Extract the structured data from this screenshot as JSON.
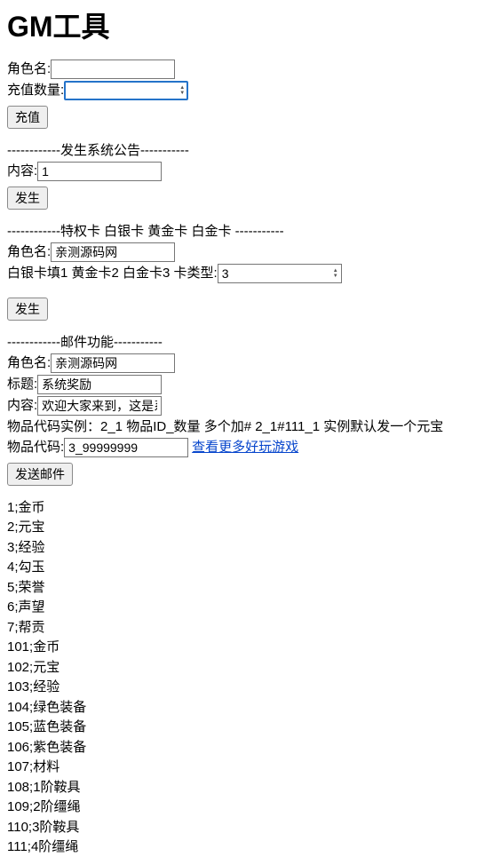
{
  "title": "GM工具",
  "recharge": {
    "role_label": "角色名:",
    "role_value": "",
    "amount_label": "充值数量:",
    "amount_value": "",
    "button": "充值"
  },
  "announce": {
    "divider": "------------发生系统公告-----------",
    "content_label": "内容:",
    "content_value": "1",
    "button": "发生"
  },
  "card": {
    "divider": "------------特权卡 白银卡 黄金卡 白金卡 -----------",
    "role_label": "角色名:",
    "role_value": "亲测源码网",
    "type_label_line": "白银卡填1 黄金卡2 白金卡3 卡类型:",
    "type_value": "3",
    "button": "发生"
  },
  "mail": {
    "divider": "------------邮件功能-----------",
    "role_label": "角色名:",
    "role_value": "亲测源码网",
    "title_label": "标题:",
    "title_value": "系统奖励",
    "content_label": "内容:",
    "content_value": "欢迎大家来到，这是系统",
    "code_example": "物品代码实例：2_1 物品ID_数量 多个加# 2_1#111_1 实例默认发一个元宝",
    "code_label": "物品代码:",
    "code_value": "3_99999999",
    "link_text": "查看更多好玩游戏",
    "button": "发送邮件"
  },
  "items": [
    "1;金币",
    "2;元宝",
    "3;经验",
    "4;勾玉",
    "5;荣誉",
    "6;声望",
    "7;帮贡",
    "101;金币",
    "102;元宝",
    "103;经验",
    "104;绿色装备",
    "105;蓝色装备",
    "106;紫色装备",
    "107;材料",
    "108;1阶鞍具",
    "109;2阶缰绳",
    "110;3阶鞍具",
    "111;4阶缰绳"
  ]
}
